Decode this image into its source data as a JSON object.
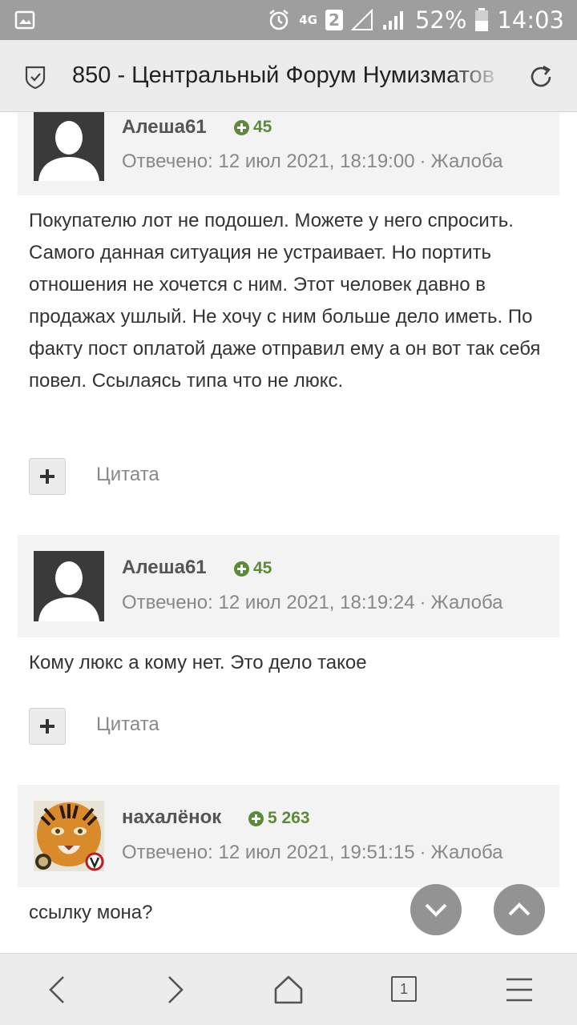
{
  "status_bar": {
    "network": "4G",
    "sim": "2",
    "battery": "52%",
    "time": "14:03"
  },
  "toolbar": {
    "title": "850 - Центральный Форум Нумизматов"
  },
  "posts": [
    {
      "author": "Алеша61",
      "reputation": "45",
      "meta_prefix": "Отвечено:",
      "date": "12 июл 2021, 18:19:00",
      "report": "Жалоба",
      "body": "Покупателю лот не подошел. Можете у него спросить. Самого данная ситуация не устраивает. Но портить отношения не хочется с ним. Этот человек давно в продажах ушлый. Не хочу с ним больше дело иметь. По факту пост оплатой даже отправил ему а он вот так себя повел. Ссылаясь типа что не люкс.",
      "quote": "Цитата",
      "avatar": "default-user-avatar"
    },
    {
      "author": "Алеша61",
      "reputation": "45",
      "meta_prefix": "Отвечено:",
      "date": "12 июл 2021, 18:19:24",
      "report": "Жалоба",
      "body": "Кому люкс а кому нет. Это дело такое",
      "quote": "Цитата",
      "avatar": "default-user-avatar"
    },
    {
      "author": "нахалёнок",
      "reputation": "5 263",
      "meta_prefix": "Отвечено:",
      "date": "12 июл 2021, 19:51:15",
      "report": "Жалоба",
      "body": "ссылку мона?",
      "avatar": "tiger-avatar"
    }
  ],
  "bottom_nav": {
    "tab_count": "1"
  },
  "colors": {
    "reputation": "#5d8a3a",
    "header_bg": "#f3f3f3",
    "status_bar": "#9e9e9e"
  }
}
